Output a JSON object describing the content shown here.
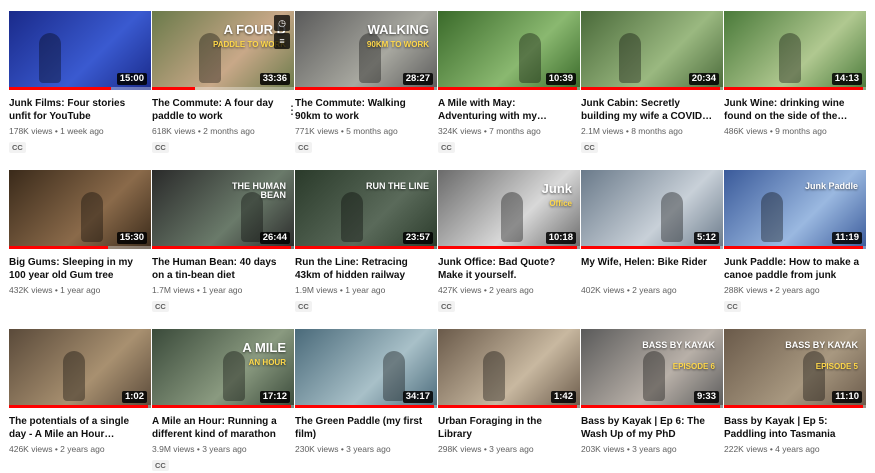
{
  "videos": [
    {
      "title": "Junk Films: Four stories unfit for YouTube",
      "views": "178K views",
      "age": "1 week ago",
      "duration": "15:00",
      "cc": "CC",
      "progress": 0.72,
      "thumb_text": "",
      "thumb_subtext": ""
    },
    {
      "title": "The Commute: A four day paddle to work",
      "views": "618K views",
      "age": "2 months ago",
      "duration": "33:36",
      "cc": "CC",
      "progress": 0.3,
      "thumb_text": "A FOUR D",
      "thumb_subtext": "PADDLE TO WORK"
    },
    {
      "title": "The Commute: Walking 90km to work",
      "views": "771K views",
      "age": "5 months ago",
      "duration": "28:27",
      "cc": "CC",
      "progress": 0.98,
      "thumb_text": "WALKING",
      "thumb_subtext": "90KM TO WORK"
    },
    {
      "title": "A Mile with May: Adventuring with my…",
      "views": "324K views",
      "age": "7 months ago",
      "duration": "10:39",
      "cc": "CC",
      "progress": 0.98,
      "thumb_text": "",
      "thumb_subtext": ""
    },
    {
      "title": "Junk Cabin: Secretly building my wife a COVID…",
      "views": "2.1M views",
      "age": "8 months ago",
      "duration": "20:34",
      "cc": "CC",
      "progress": 0.98,
      "thumb_text": "",
      "thumb_subtext": ""
    },
    {
      "title": "Junk Wine: drinking wine found on the side of the…",
      "views": "486K views",
      "age": "9 months ago",
      "duration": "14:13",
      "cc": "",
      "progress": 0.98,
      "thumb_text": "",
      "thumb_subtext": ""
    },
    {
      "title": "Big Gums: Sleeping in my 100 year old Gum tree",
      "views": "432K views",
      "age": "1 year ago",
      "duration": "15:30",
      "cc": "",
      "progress": 0.7,
      "thumb_text": "",
      "thumb_subtext": ""
    },
    {
      "title": "The Human Bean: 40 days on a tin-bean diet",
      "views": "1.7M views",
      "age": "1 year ago",
      "duration": "26:44",
      "cc": "CC",
      "progress": 0.98,
      "thumb_text": "THE HUMAN BEAN",
      "thumb_subtext": ""
    },
    {
      "title": "Run the Line: Retracing 43km of hidden railway",
      "views": "1.9M views",
      "age": "1 year ago",
      "duration": "23:57",
      "cc": "CC",
      "progress": 0.98,
      "thumb_text": "RUN THE LINE",
      "thumb_subtext": ""
    },
    {
      "title": "Junk Office: Bad Quote? Make it yourself.",
      "views": "427K views",
      "age": "2 years ago",
      "duration": "10:18",
      "cc": "CC",
      "progress": 0.98,
      "thumb_text": "Junk",
      "thumb_subtext": "Office"
    },
    {
      "title": "My Wife, Helen: Bike Rider",
      "views": "402K views",
      "age": "2 years ago",
      "duration": "5:12",
      "cc": "",
      "progress": 0.98,
      "thumb_text": "",
      "thumb_subtext": ""
    },
    {
      "title": "Junk Paddle: How to make a canoe paddle from junk",
      "views": "288K views",
      "age": "2 years ago",
      "duration": "11:19",
      "cc": "CC",
      "progress": 0.98,
      "thumb_text": "Junk Paddle",
      "thumb_subtext": ""
    },
    {
      "title": "The potentials of a single day - A Mile an Hour…",
      "views": "426K views",
      "age": "2 years ago",
      "duration": "1:02",
      "cc": "",
      "progress": 0.98,
      "thumb_text": "",
      "thumb_subtext": ""
    },
    {
      "title": "A Mile an Hour: Running a different kind of marathon",
      "views": "3.9M views",
      "age": "3 years ago",
      "duration": "17:12",
      "cc": "CC",
      "progress": 0.98,
      "thumb_text": "A MILE",
      "thumb_subtext": "AN HOUR"
    },
    {
      "title": "The Green Paddle (my first film)",
      "views": "230K views",
      "age": "3 years ago",
      "duration": "34:17",
      "cc": "",
      "progress": 0.98,
      "thumb_text": "",
      "thumb_subtext": ""
    },
    {
      "title": "Urban Foraging in the Library",
      "views": "298K views",
      "age": "3 years ago",
      "duration": "1:42",
      "cc": "",
      "progress": 0.98,
      "thumb_text": "",
      "thumb_subtext": ""
    },
    {
      "title": "Bass by Kayak | Ep 6: The Wash Up of my PhD",
      "views": "203K views",
      "age": "3 years ago",
      "duration": "9:33",
      "cc": "",
      "progress": 0.98,
      "thumb_text": "BASS BY KAYAK",
      "thumb_subtext": "EPISODE 6"
    },
    {
      "title": "Bass by Kayak | Ep 5: Paddling into Tasmania",
      "views": "222K views",
      "age": "4 years ago",
      "duration": "11:10",
      "cc": "",
      "progress": 0.98,
      "thumb_text": "BASS BY KAYAK",
      "thumb_subtext": "EPISODE 5"
    }
  ],
  "thumb_colors": [
    [
      "#1a2a8a",
      "#3a5ad0"
    ],
    [
      "#6a7a4a",
      "#c8a888"
    ],
    [
      "#5a5a5a",
      "#a8a8a0"
    ],
    [
      "#3a6a2a",
      "#8ab870"
    ],
    [
      "#4a6a3a",
      "#9ab880"
    ],
    [
      "#4a7a3a",
      "#b0c890"
    ],
    [
      "#3a2a1a",
      "#8a6a4a"
    ],
    [
      "#2a2a2a",
      "#6a7a6a"
    ],
    [
      "#2a3a2a",
      "#5a6a5a"
    ],
    [
      "#6a6a6a",
      "#d8d8d8"
    ],
    [
      "#6a7a8a",
      "#c8d0d8"
    ],
    [
      "#3a5a9a",
      "#9ab8e0"
    ],
    [
      "#5a4a3a",
      "#a89070"
    ],
    [
      "#3a4a3a",
      "#8a9a80"
    ],
    [
      "#4a6a7a",
      "#a8c0c8"
    ],
    [
      "#6a5a4a",
      "#c8b8a0"
    ],
    [
      "#5a5a5a",
      "#b8b0a8"
    ],
    [
      "#6a5a4a",
      "#a89880"
    ]
  ],
  "accent_color": "#ff0000",
  "hover_icons": [
    "clock-icon",
    "queue-icon"
  ]
}
